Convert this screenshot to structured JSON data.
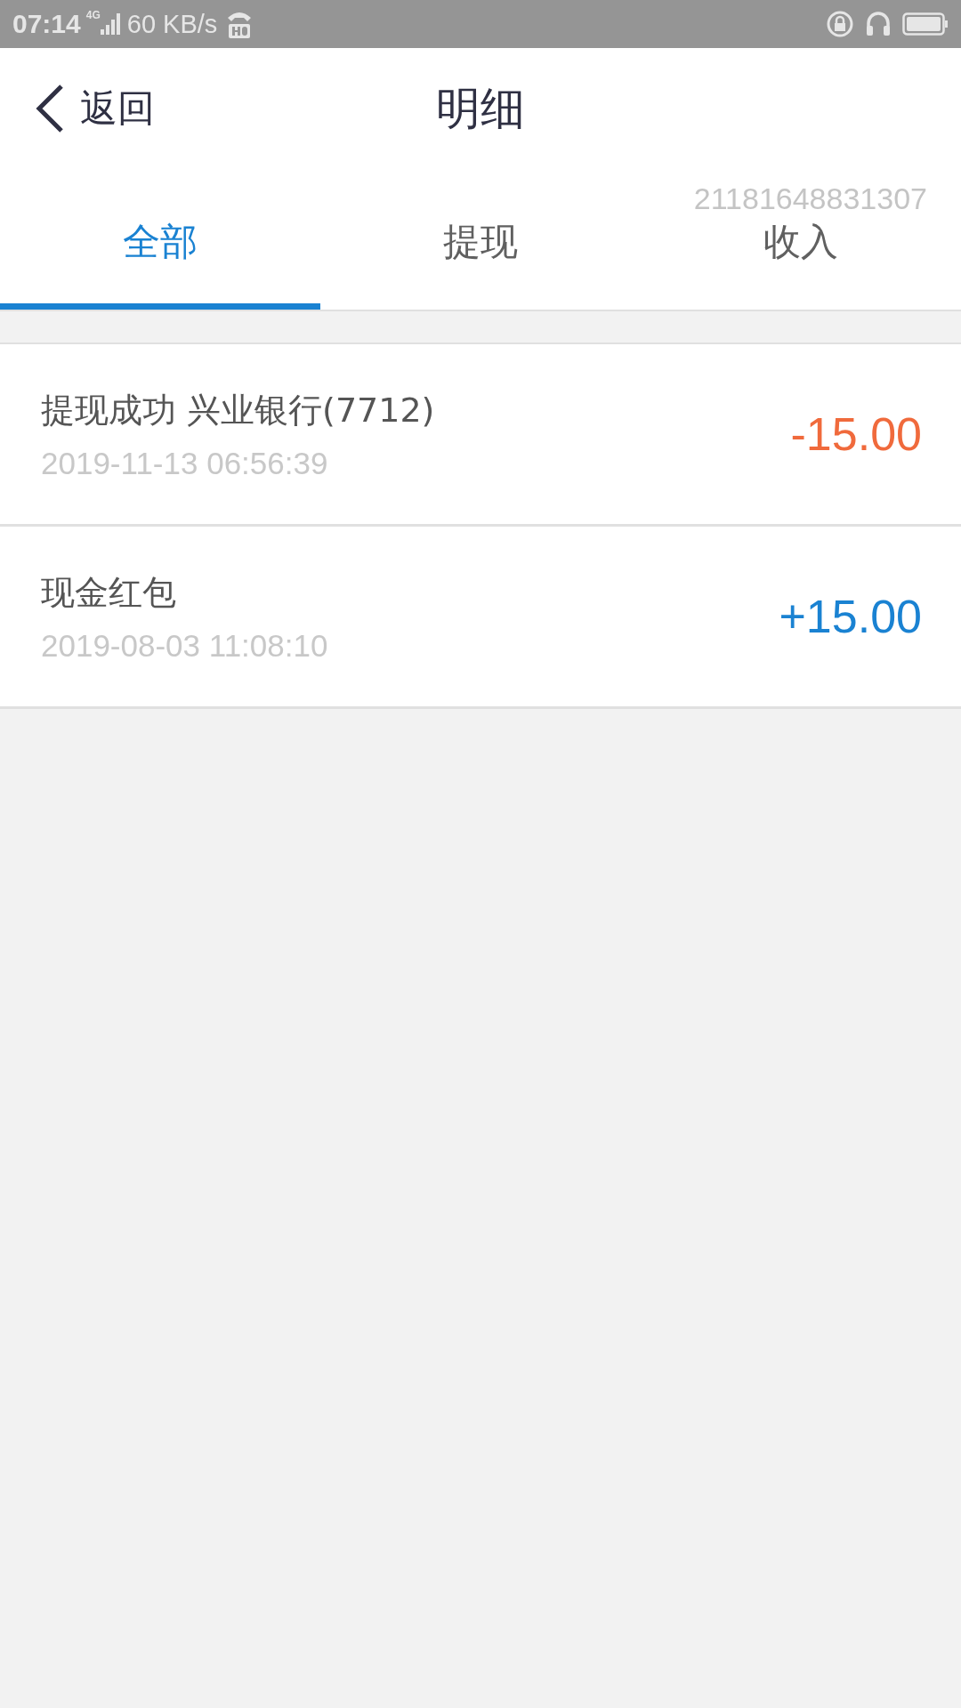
{
  "status_bar": {
    "time": "07:14",
    "network": "4G",
    "speed": "60 KB/s"
  },
  "header": {
    "back_label": "返回",
    "title": "明细"
  },
  "user_id": "21181648831307",
  "tabs": [
    {
      "label": "全部",
      "selected": true
    },
    {
      "label": "提现",
      "selected": false
    },
    {
      "label": "收入",
      "selected": false
    }
  ],
  "transactions": [
    {
      "title": "提现成功 兴业银行(7712)",
      "time": "2019-11-13 06:56:39",
      "amount": "-15.00",
      "color": "#f06a3c"
    },
    {
      "title": "现金红包",
      "time": "2019-08-03 11:08:10",
      "amount": "+15.00",
      "color": "#1a82d2"
    }
  ]
}
